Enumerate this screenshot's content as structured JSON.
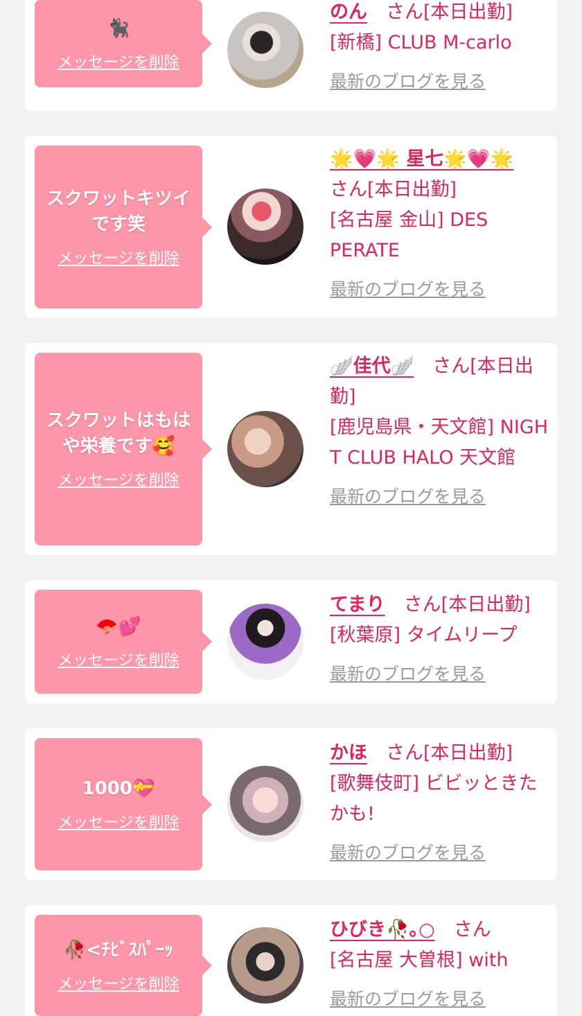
{
  "delete_label": "メッセージを削除",
  "blog_label": "最新のブログを見る",
  "san_suffix": "さん",
  "colors": {
    "accent": "#e0245e",
    "bubble": "#fd96a8",
    "muted": "#9a9a9a",
    "background": "#f2f2f2"
  },
  "cards": [
    {
      "message": "🐈‍⬛",
      "name": "のん",
      "status": "[本日出勤]",
      "shop": "[新橋] CLUB M-carlo"
    },
    {
      "message": "スクワットキツイです笑",
      "name": "🌟💗🌟 星七🌟💗🌟",
      "status": "[本日出勤]",
      "shop": "[名古屋 金山] DESPERATE"
    },
    {
      "message": "スクワットはもはや栄養です🥰",
      "name": "🪽佳代🪽",
      "status": "[本日出勤]",
      "shop": "[鹿児島県・天文館] NIGHT CLUB HALO 天文館"
    },
    {
      "message": "🪭💕",
      "name": "てまり",
      "status": "[本日出勤]",
      "shop": "[秋葉原] タイムリープ"
    },
    {
      "message": "1000💝",
      "name": "かほ",
      "status": "[本日出勤]",
      "shop": "[歌舞伎町] ビビッときたかも!"
    },
    {
      "message": "🥀<ﾁﾋﾞｽﾊﾟｰｯ",
      "name": "ひびき🥀｡○",
      "status": "",
      "shop": "[名古屋 大曽根] with"
    }
  ]
}
